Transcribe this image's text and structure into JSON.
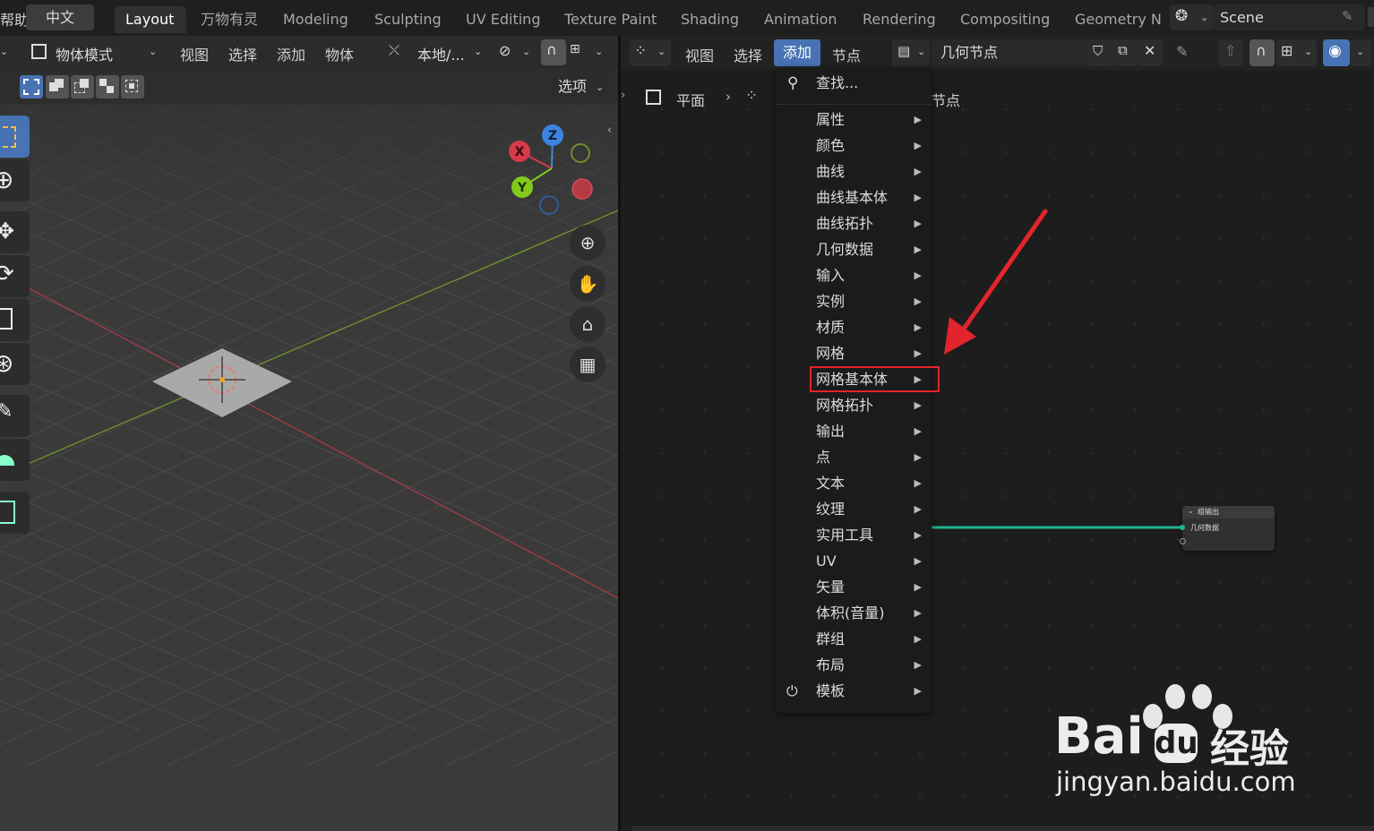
{
  "topbar": {
    "left_fragment": "帮助",
    "lang_button": "中文",
    "tabs": [
      "Layout",
      "万物有灵",
      "Modeling",
      "Sculpting",
      "UV Editing",
      "Texture Paint",
      "Shading",
      "Animation",
      "Rendering",
      "Compositing",
      "Geometry N"
    ],
    "active_tab": "Layout",
    "scene_name": "Scene"
  },
  "viewport": {
    "mode_label": "物体模式",
    "menus": [
      "视图",
      "选择",
      "添加",
      "物体"
    ],
    "transform_label": "本地/...",
    "options_label": "选项",
    "gizmo": {
      "x": "X",
      "y": "Y",
      "z": "Z"
    }
  },
  "node_editor": {
    "menus": [
      "视图",
      "选择",
      "添加",
      "节点"
    ],
    "active_menu": "添加",
    "node_group_name": "几何节点",
    "breadcrumb_object": "平面",
    "breadcrumb_tail": "节点",
    "output_node": {
      "title": "组输出",
      "socket": "几何数据"
    }
  },
  "add_menu": {
    "search_label": "查找...",
    "items": [
      "属性",
      "颜色",
      "曲线",
      "曲线基本体",
      "曲线拓扑",
      "几何数据",
      "输入",
      "实例",
      "材质",
      "网格",
      "网格基本体",
      "网格拓扑",
      "输出",
      "点",
      "文本",
      "纹理",
      "实用工具",
      "UV",
      "矢量",
      "体积(音量)",
      "群组",
      "布局",
      "模板"
    ],
    "highlighted": "网格基本体"
  },
  "watermark": {
    "brand": "Bai",
    "brand_cn": "经验",
    "url": "jingyan.baidu.com"
  },
  "colors": {
    "accent_blue": "#4772b3",
    "highlight_red": "#e3242b",
    "link_teal": "#1fb590"
  }
}
